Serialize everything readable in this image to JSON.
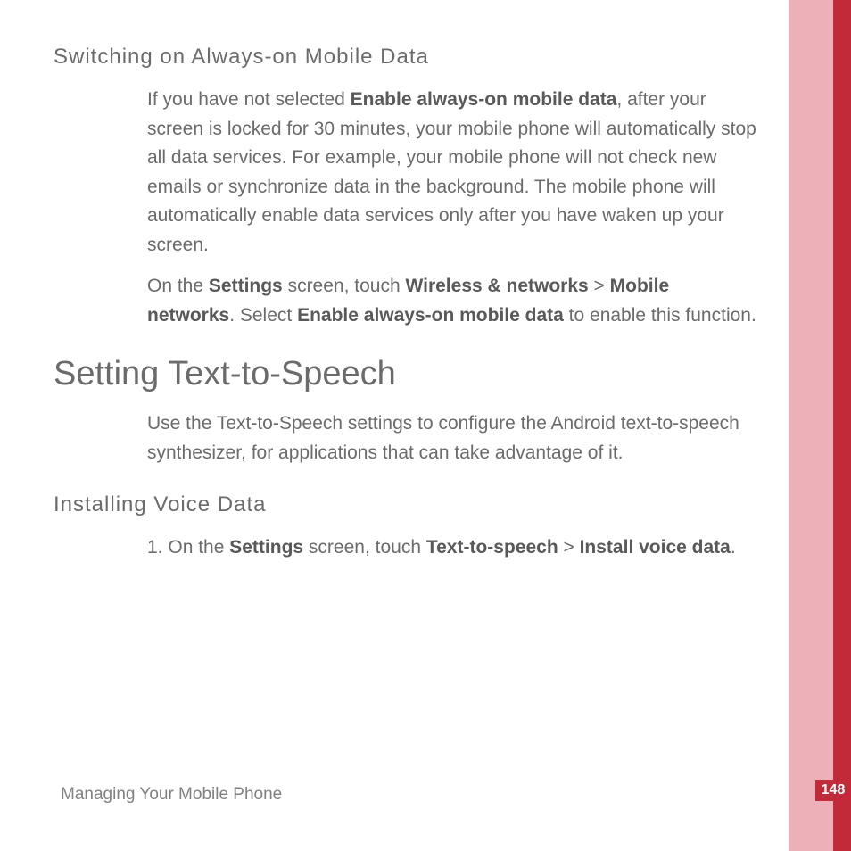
{
  "page": {
    "number": "148",
    "footer": "Managing Your Mobile Phone"
  },
  "section1": {
    "heading": "Switching on Always-on Mobile Data",
    "p1": {
      "t1": "If you have not selected ",
      "b1": "Enable always-on mobile data",
      "t2": ", after your screen is locked for 30 minutes, your mobile phone will automatically stop all data services. For example, your mobile phone will not check new emails or synchronize data in the background. The mobile phone will automatically enable data services only after you have waken up your screen."
    },
    "p2": {
      "t1": "On the ",
      "b1": "Settings",
      "t2": " screen, touch ",
      "b2": "Wireless & networks",
      "t3": " > ",
      "b3": "Mobile networks",
      "t4": ". Select ",
      "b4": "Enable always-on mobile data",
      "t5": " to enable this function."
    }
  },
  "section2": {
    "heading": "Setting Text-to-Speech",
    "p1": "Use the Text-to-Speech settings to configure the Android text-to-speech synthesizer, for applications that can take advantage of it."
  },
  "section3": {
    "heading": "Installing Voice Data",
    "step1": {
      "num": "1. ",
      "t1": "On the ",
      "b1": "Settings",
      "t2": " screen, touch ",
      "b2": "Text-to-speech",
      "t3": " > ",
      "b3": "Install voice data",
      "t4": "."
    }
  }
}
